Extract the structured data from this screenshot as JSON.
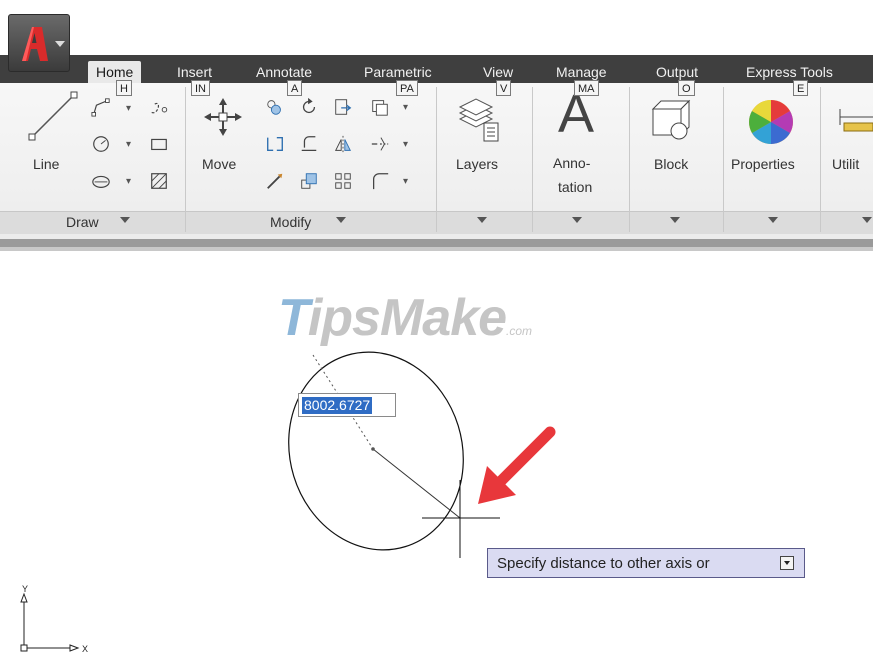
{
  "app": {
    "name": "AutoCAD",
    "logo_letter": "A"
  },
  "tabs": [
    {
      "label": "Home",
      "keytip": "H",
      "active": true
    },
    {
      "label": "Insert",
      "keytip": "IN"
    },
    {
      "label": "Annotate",
      "keytip": "A"
    },
    {
      "label": "Parametric",
      "keytip": "PA"
    },
    {
      "label": "View",
      "keytip": "V"
    },
    {
      "label": "Manage",
      "keytip": "MA"
    },
    {
      "label": "Output",
      "keytip": "O"
    },
    {
      "label": "Express Tools",
      "keytip": "E"
    }
  ],
  "ribbon": {
    "draw": {
      "title": "Draw",
      "line_label": "Line"
    },
    "modify": {
      "title": "Modify",
      "move_label": "Move"
    },
    "layers_label": "Layers",
    "annotation_label_1": "Anno-",
    "annotation_label_2": "tation",
    "block_label": "Block",
    "properties_label": "Properties",
    "utilities_label": "Utilit"
  },
  "canvas": {
    "watermark": {
      "main": "ipsMake",
      "first_letter": "T",
      "suffix": ".com"
    },
    "dimension_value": "8002.6727",
    "tooltip": "Specify distance to other axis or",
    "ucs": {
      "y_label": "Y",
      "x_label": "X"
    }
  },
  "colors": {
    "accent_red": "#e8373b",
    "tab_bar": "#3f3f3f",
    "selection": "#2f6cc4",
    "tooltip_bg": "#dadbf2"
  }
}
